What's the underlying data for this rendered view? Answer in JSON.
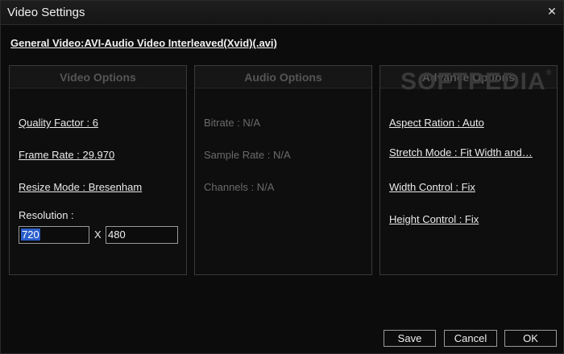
{
  "window": {
    "title": "Video Settings",
    "close_glyph": "✕"
  },
  "general": {
    "label": "General Video:AVI-Audio Video Interleaved(Xvid)(.avi)"
  },
  "video": {
    "header": "Video Options",
    "quality": "Quality Factor : 6",
    "frame_rate": "Frame Rate : 29.970",
    "resize_mode": "Resize Mode : Bresenham",
    "resolution_label": "Resolution :",
    "width": "720",
    "x_sep": "X",
    "height": "480"
  },
  "audio": {
    "header": "Audio Options",
    "bitrate": "Bitrate : N/A",
    "sample_rate": "Sample Rate : N/A",
    "channels": "Channels : N/A"
  },
  "advance": {
    "header": "Advance Options",
    "aspect": "Aspect Ration : Auto",
    "stretch": "Stretch Mode : Fit Width and…",
    "width_control": "Width Control : Fix",
    "height_control": "Height Control : Fix"
  },
  "watermark": {
    "text": "SOFTPEDIA",
    "mark": "®"
  },
  "buttons": {
    "save": "Save",
    "cancel": "Cancel",
    "ok": "OK"
  }
}
